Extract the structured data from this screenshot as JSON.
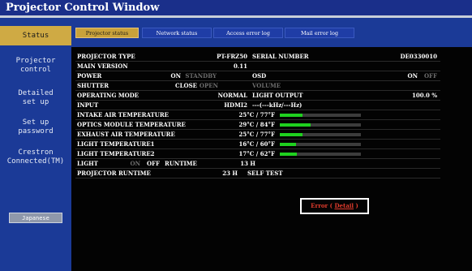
{
  "window_title": "Projector Control Window",
  "sidebar": {
    "items": [
      {
        "label": "Status"
      },
      {
        "label": "Projector\ncontrol"
      },
      {
        "label": "Detailed\nset up"
      },
      {
        "label": "Set up\npassword"
      },
      {
        "label": "Crestron\nConnected(TM)"
      }
    ],
    "language_button": "Japanese"
  },
  "tabs": [
    {
      "label": "Projector status"
    },
    {
      "label": "Network status"
    },
    {
      "label": "Access error log"
    },
    {
      "label": "Mail error log"
    }
  ],
  "status": {
    "projector_type_label": "PROJECTOR TYPE",
    "projector_type_value": "PT-FRZ50",
    "serial_label": "SERIAL NUMBER",
    "serial_value": "DE0330010",
    "main_version_label": "MAIN VERSION",
    "main_version_value": "0.11",
    "power_label": "POWER",
    "power_on": "ON",
    "power_standby": "STANDBY",
    "osd_label": "OSD",
    "osd_on": "ON",
    "osd_off": "OFF",
    "shutter_label": "SHUTTER",
    "shutter_close": "CLOSE",
    "shutter_open": "OPEN",
    "volume_label": "VOLUME",
    "operating_mode_label": "OPERATING MODE",
    "operating_mode_value": "NORMAL",
    "light_output_label": "LIGHT OUTPUT",
    "light_output_value": "100.0 %",
    "input_label": "INPUT",
    "input_value": "HDMI2",
    "input_freq": "---(---kHz/---Hz)",
    "intake_temp_label": "INTAKE AIR TEMPERATURE",
    "intake_temp_value": "25°C / 77°F",
    "intake_temp_level": 0.28,
    "optics_temp_label": "OPTICS MODULE TEMPERATURE",
    "optics_temp_value": "29°C / 84°F",
    "optics_temp_level": 0.38,
    "exhaust_temp_label": "EXHAUST AIR TEMPERATURE",
    "exhaust_temp_value": "25°C / 77°F",
    "exhaust_temp_level": 0.28,
    "light1_temp_label": "LIGHT TEMPERATURE1",
    "light1_temp_value": "16°C / 60°F",
    "light1_temp_level": 0.2,
    "light2_temp_label": "LIGHT TEMPERATURE2",
    "light2_temp_value": "17°C / 62°F",
    "light2_temp_level": 0.21,
    "light_label": "LIGHT",
    "light_on": "ON",
    "light_off": "OFF",
    "runtime_label": "RUNTIME",
    "runtime_value": "13 H",
    "proj_runtime_label": "PROJECTOR RUNTIME",
    "proj_runtime_value": "23 H",
    "self_test_label": "SELF TEST",
    "self_test_prefix": "Error (",
    "self_test_link": "Detail",
    "self_test_suffix": ")"
  },
  "colors": {
    "accent_gold": "#cfaa44",
    "nav_blue": "#1b3a97",
    "bar_green": "#1fd11f",
    "error_red": "#e03b2c"
  }
}
